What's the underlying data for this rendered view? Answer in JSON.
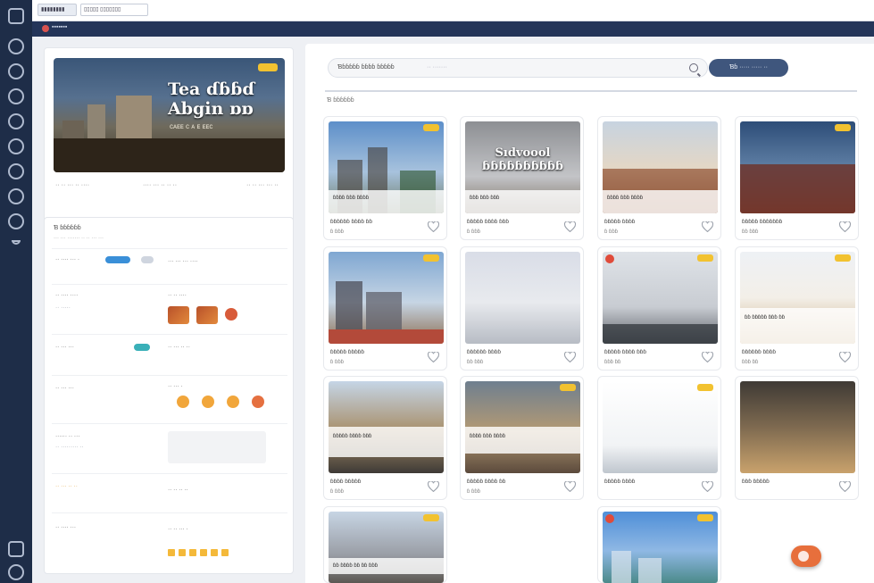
{
  "topbar": {
    "chip_a": "▮▮▮▮▮▮▮▮",
    "chip_b": "▯▯▯▯▯ ▯▯▯▯▯▯▯"
  },
  "nav": {
    "title": "▪▪▪▪▪▪▪"
  },
  "featured": {
    "title_line1": "Tea ɗɓɓɗ",
    "title_line2": "Abgin ɒɒ",
    "subtitle": "ᴄᴀᴇᴇ ᴄ ᴀ ᴇ ᴇᴇᴄ",
    "meta_left": "·· ·· ··· ·· ····",
    "meta_mid": "···· ··· ·· ·· ··",
    "meta_right": "·· ·· ··· ··· ··"
  },
  "filters": {
    "heading": "Ɓ ɓɓɓɓɓɓ",
    "subheading": "··· ··· ······· ·· ·· ··· ···",
    "rows": [
      {
        "left": "·· ···· ··· ·",
        "right": "··· ··· ··· ····"
      },
      {
        "left": "·· ···· ····",
        "right": "·· ·· ····"
      },
      {
        "left": "·· ··· ···",
        "right": "·· ··· ·· ··"
      },
      {
        "left": "·· ··· ···",
        "right": "·· ··· ·"
      },
      {
        "left": "······ ·· ···",
        "right": ""
      },
      {
        "left": "·· ··· ·· ··",
        "right": "·· ·· ·· ··"
      },
      {
        "left": "·· ···· ···",
        "right": "·· ·· ··· ·"
      }
    ]
  },
  "search": {
    "query": "Ɓɓɓɓɓɓ ɓɓɓɓ ɓɓɓɓɓ",
    "placeholder": "·· ·······",
    "button": "Ɓɓ ····· ····· ··"
  },
  "results_label": "Ɓ ɓɓɓɓɓɓ",
  "tiles": [
    {
      "name": "ɓɓɓɓɓɓ ɓɓɓɓ ɓɓ",
      "loc": "ɓ ɓɓɓ",
      "caption": "ɓɓɓɓ ɓɓɓ ɓɓɓɓ",
      "big": ""
    },
    {
      "name": "ɓɓɓɓɓ ɓɓɓɓ ɓɓɓ",
      "loc": "ɓ ɓɓɓ",
      "caption": "ɓɓɓ ɓɓɓ ɓɓɓ",
      "big": "Sıdvoool ɓɓɓɓɓɓɓɓɓɓ"
    },
    {
      "name": "ɓɓɓɓɓ ɓɓɓɓ",
      "loc": "ɓ ɓɓɓ",
      "caption": "ɓɓɓɓ ɓɓɓ ɓɓɓɓ",
      "big": ""
    },
    {
      "name": "ɓɓɓɓɓ ɓɓɓɓɓɓɓ",
      "loc": "ɓɓ ɓɓɓ",
      "caption": "",
      "big": ""
    },
    {
      "name": "ɓɓɓɓɓ ɓɓɓɓɓ",
      "loc": "ɓ ɓɓɓ",
      "caption": "",
      "big": ""
    },
    {
      "name": "ɓɓɓɓɓɓ ɓɓɓɓ",
      "loc": "ɓɓ ɓɓɓ",
      "caption": "",
      "big": ""
    },
    {
      "name": "ɓɓɓɓɓ ɓɓɓɓ ɓɓɓ",
      "loc": "ɓɓɓ ɓɓ",
      "caption": "",
      "big": ""
    },
    {
      "name": "ɓɓɓɓɓɓ ɓɓɓɓ",
      "loc": "ɓɓɓ ɓɓ",
      "caption": "ɓɓ ɓɓɓɓɓ ɓɓɓ ɓɓ",
      "big": ""
    },
    {
      "name": "ɓɓɓɓ ɓɓɓɓɓ",
      "loc": "ɓ ɓɓɓ",
      "caption": "ɓɓɓɓɓ ɓɓɓɓ ɓɓɓ",
      "big": ""
    },
    {
      "name": "ɓɓɓɓɓ ɓɓɓɓ ɓɓ",
      "loc": "ɓ ɓɓɓ",
      "caption": "ɓɓɓɓ ɓɓɓ ɓɓɓɓ",
      "big": ""
    },
    {
      "name": "ɓɓɓɓɓ ɓɓɓɓ",
      "loc": "",
      "caption": "",
      "big": ""
    },
    {
      "name": "ɓɓɓ ɓɓɓɓɓ",
      "loc": "",
      "caption": "",
      "big": ""
    },
    {
      "name": "",
      "loc": "",
      "caption": "ɓɓ ɓɓɓɓ ɓɓ ɓɓ ɓɓɓ",
      "big": ""
    },
    {
      "name": "",
      "loc": "",
      "caption": "",
      "big": ""
    }
  ],
  "colors": {
    "sidebar": "#1e2d48",
    "nav": "#243559",
    "accent_button": "#3f567d",
    "tag": "#f2c230",
    "fab": "#e76f3c"
  }
}
